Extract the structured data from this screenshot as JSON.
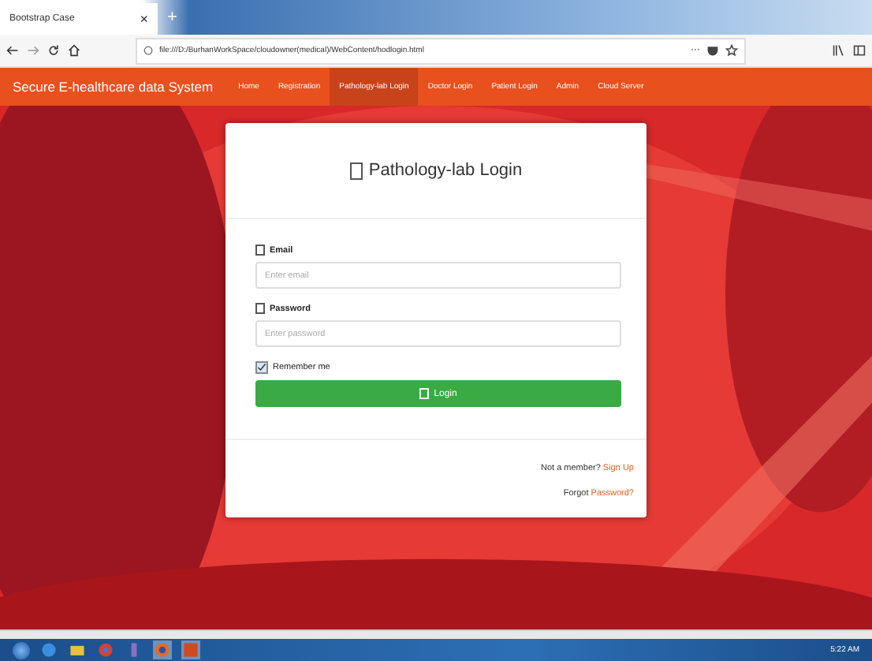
{
  "browser": {
    "tab_title": "Bootstrap Case",
    "close": "×",
    "new_tab": "+",
    "url": "file:///D:/BurhanWorkSpace/cloudowner(medical)/WebContent/hodlogin.html",
    "menu": "···"
  },
  "navbar": {
    "brand": "Secure E-healthcare data System",
    "items": [
      {
        "label": "Home",
        "selected": false
      },
      {
        "label": "Registration",
        "selected": false
      },
      {
        "label": "Pathology-lab Login",
        "selected": true
      },
      {
        "label": "Doctor Login",
        "selected": false
      },
      {
        "label": "Patient Login",
        "selected": false
      },
      {
        "label": "Admin",
        "selected": false
      },
      {
        "label": "Cloud Server",
        "selected": false
      }
    ]
  },
  "card": {
    "title": "Pathology-lab Login",
    "fields": [
      {
        "label": "Email",
        "placeholder": "Enter email"
      },
      {
        "label": "Password",
        "placeholder": "Enter password"
      }
    ],
    "remember": {
      "label": "Remember me",
      "checked": true
    },
    "button": "Login",
    "signup_text": "Not a member?",
    "signup_link": "Sign Up",
    "forgot_text": "Forgot",
    "forgot_link": "Password?"
  },
  "taskbar": {
    "clock": "5:22 AM"
  }
}
